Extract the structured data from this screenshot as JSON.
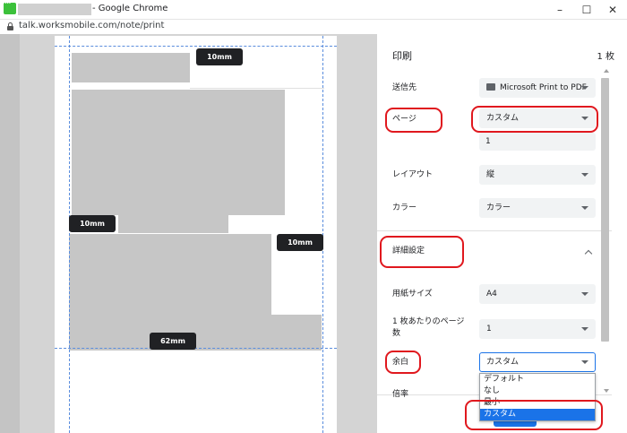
{
  "window": {
    "title": "- Google Chrome",
    "controls": {
      "minimize": "–",
      "maximize": "☐",
      "close": "✕"
    }
  },
  "address_bar": {
    "url": "talk.worksmobile.com/note/print"
  },
  "preview": {
    "margin_chips": [
      "10mm",
      "10mm",
      "10mm",
      "62mm"
    ]
  },
  "print_panel": {
    "title": "印刷",
    "sheet_count": "1 枚",
    "destination": {
      "label": "送信先",
      "value": "Microsoft Print to PDF"
    },
    "pages": {
      "label": "ページ",
      "value": "カスタム",
      "range_value": "1"
    },
    "layout": {
      "label": "レイアウト",
      "value": "縦"
    },
    "color": {
      "label": "カラー",
      "value": "カラー"
    },
    "advanced": {
      "label": "詳細設定"
    },
    "paper_size": {
      "label": "用紙サイズ",
      "value": "A4"
    },
    "pages_per_sheet": {
      "label_line1": "1 枚あたりのページ",
      "label_line2": "数",
      "value": "1"
    },
    "margins": {
      "label": "余白",
      "value": "カスタム",
      "options": [
        "デフォルト",
        "なし",
        "最小",
        "カスタム"
      ],
      "selected_index": 3
    },
    "scale": {
      "label": "倍率"
    }
  },
  "colors": {
    "accent": "#1a73e8",
    "annotation": "#e0181e"
  }
}
